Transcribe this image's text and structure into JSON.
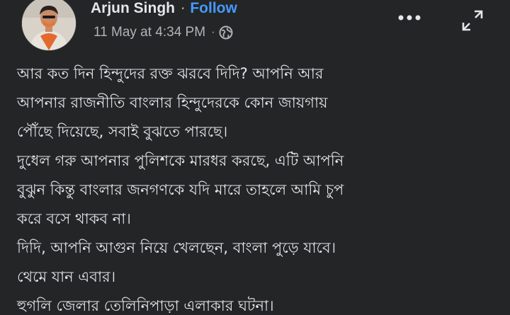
{
  "post": {
    "author": {
      "name": "Arjun Singh",
      "follow_label": "Follow",
      "separator": "·"
    },
    "meta": {
      "timestamp": "11 May at 4:34 PM",
      "separator": "·",
      "privacy_icon": "globe-icon"
    },
    "actions": {
      "more_icon": "more-horizontal-icon",
      "expand_icon": "expand-icon"
    },
    "body_lines": [
      "আর কত দিন হিন্দুদের রক্ত ঝরবে দিদি? আপনি আর",
      "আপনার রাজনীতি বাংলার হিন্দুদেরকে কোন জায়গায়",
      "পৌঁছে দিয়েছে, সবাই বুঝতে পারছে।",
      "দুধেল গরু আপনার পুলিশকে মারধর করছে, এটি আপনি",
      "বুঝুন কিন্তু বাংলার জনগণকে যদি মারে তাহলে আমি চুপ",
      "করে বসে থাকব না।",
      "দিদি, আপনি আগুন নিয়ে খেলছেন, বাংলা পুড়ে যাবে।",
      "থেমে যান এবার।",
      "হুগলি জেলার তেলিনিপাড়া এলাকার ঘটনা।"
    ]
  },
  "colors": {
    "background": "#242526",
    "text_primary": "#e4e6eb",
    "text_secondary": "#b0b3b8",
    "link": "#4599ff"
  }
}
